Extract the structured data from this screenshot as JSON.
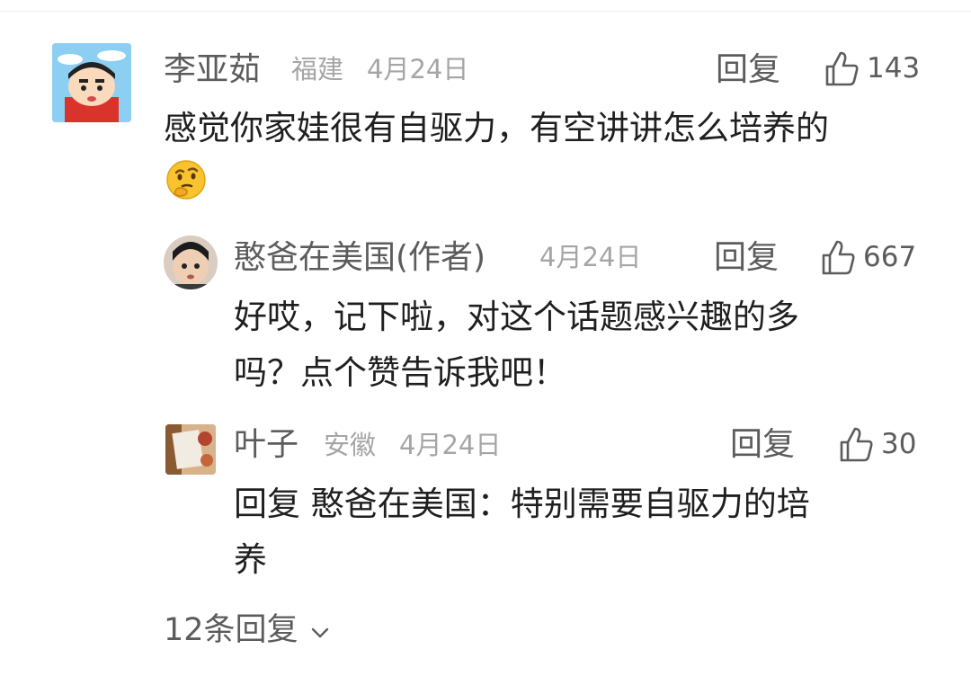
{
  "comment": {
    "user": "李亚茹",
    "location": "福建",
    "date": "4月24日",
    "reply_label": "回复",
    "likes": "143",
    "text_line1": "感觉你家娃很有自驱力，有空讲讲怎么培养的",
    "emoji": "thinking-face-emoji"
  },
  "reply1": {
    "user": "憨爸在美国(作者)",
    "date": "4月24日",
    "reply_label": "回复",
    "likes": "667",
    "text_line1": "好哎，记下啦，对这个话题感兴趣的多",
    "text_line2": "吗？点个赞告诉我吧！"
  },
  "reply2": {
    "user": "叶子",
    "location": "安徽",
    "date": "4月24日",
    "reply_label": "回复",
    "likes": "30",
    "text_line1": " 回复 憨爸在美国：特别需要自驱力的培",
    "text_line2": "养"
  },
  "more_replies": {
    "label": "12条回复",
    "icon": "chevron-down-icon"
  }
}
